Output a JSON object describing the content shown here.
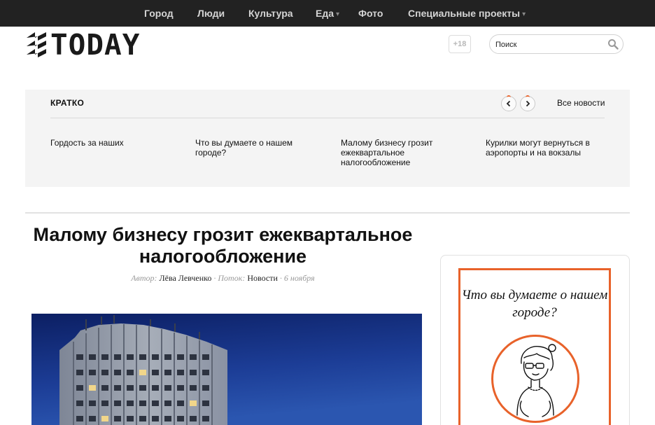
{
  "nav": {
    "items": [
      {
        "label": "Город",
        "dropdown": false
      },
      {
        "label": "Люди",
        "dropdown": false
      },
      {
        "label": "Культура",
        "dropdown": false
      },
      {
        "label": "Еда",
        "dropdown": true
      },
      {
        "label": "Фото",
        "dropdown": false
      },
      {
        "label": "Специальные проекты",
        "dropdown": true
      }
    ]
  },
  "header": {
    "logo_text": "TODAY",
    "age_badge": "+18",
    "search": {
      "placeholder": "Поиск",
      "icon": "search-icon"
    }
  },
  "brief": {
    "title": "КРАТКО",
    "all_news_label": "Все новости",
    "items": [
      {
        "text": "Гордость за наших"
      },
      {
        "text": "Что вы думаете о нашем городе?"
      },
      {
        "text": "Малому бизнесу грозит ежеквартальное налогообложение"
      },
      {
        "text": "Курилки могут вернуться в аэропорты и на вокзалы"
      }
    ]
  },
  "article": {
    "title": "Малому бизнесу грозит ежеквартальное налогообложение",
    "meta": {
      "author_label": "Автор:",
      "author": "Лёва Левченко",
      "sep1": " · ",
      "stream_label": "Поток:",
      "stream": "Новости",
      "sep2": " · ",
      "date": "6 ноября"
    }
  },
  "sidebar": {
    "promo_text": "Что вы думаете о нашем городе?"
  },
  "colors": {
    "accent": "#e8622a",
    "nav_bg": "#222222",
    "brief_bg": "#f4f4f4"
  }
}
